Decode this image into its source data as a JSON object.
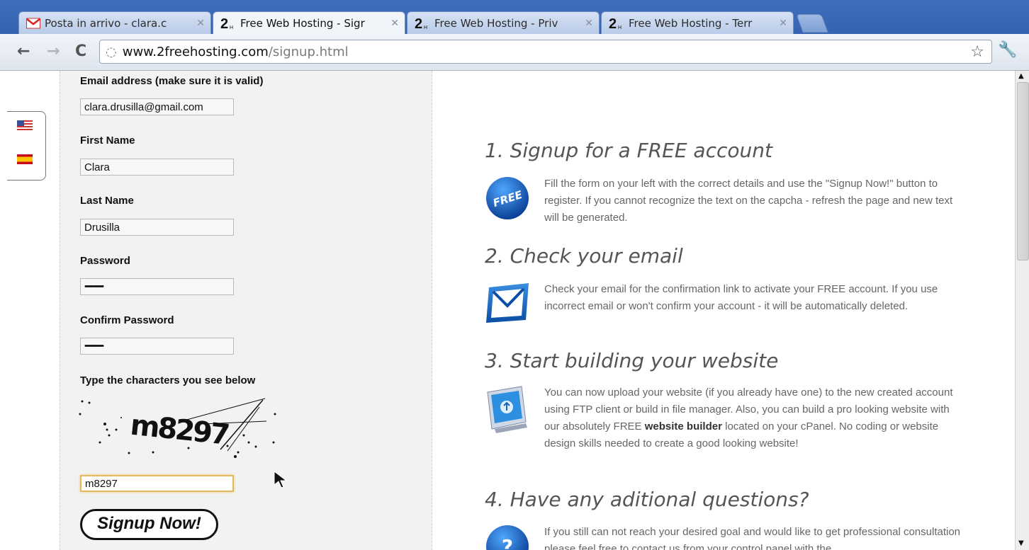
{
  "browser": {
    "tabs": [
      {
        "title": "Posta in arrivo - clara.c",
        "favicon": "gmail-icon",
        "active": false
      },
      {
        "title": "Free Web Hosting - Sigr",
        "favicon": "2freehosting-icon",
        "active": true
      },
      {
        "title": "Free Web Hosting - Priv",
        "favicon": "2freehosting-icon",
        "active": false
      },
      {
        "title": "Free Web Hosting - Terr",
        "favicon": "2freehosting-icon",
        "active": false
      }
    ],
    "url_host": "www.2freehosting.com",
    "url_path": "/signup.html"
  },
  "form": {
    "email_label": "Email address (make sure it is valid)",
    "email_value": "clara.drusilla@gmail.com",
    "first_name_label": "First Name",
    "first_name_value": "Clara",
    "last_name_label": "Last Name",
    "last_name_value": "Drusilla",
    "password_label": "Password",
    "password_value": "••••••••••••••",
    "confirm_label": "Confirm Password",
    "confirm_value": "••••••••••••••",
    "captcha_label": "Type the characters you see below",
    "captcha_image_text": "m8297",
    "captcha_value": "m8297",
    "submit_label": "Signup Now!"
  },
  "steps": [
    {
      "title": "1. Signup for a FREE account",
      "icon": "free-badge-icon",
      "icon_text": "FREE",
      "text": "Fill the form on your left with the correct details and use the \"Signup Now!\" button to register. If you cannot recognize the text on the capcha - refresh the page and new text will be generated."
    },
    {
      "title": "2. Check your email",
      "icon": "email-envelope-icon",
      "text": "Check your email for the confirmation link to activate your FREE account. If you use incorrect email or won't confirm your account - it will be automatically deleted."
    },
    {
      "title": "3. Start building your website",
      "icon": "monitor-upload-icon",
      "text_before": "You can now upload your website (if you already have one) to the new created account using FTP client or build in file manager. Also, you can build a pro looking website with our absolutely FREE ",
      "text_bold": "website builder",
      "text_after": " located on your cPanel. No coding or website design skills needed to create a good looking website!"
    },
    {
      "title": "4. Have any aditional questions?",
      "icon": "question-badge-icon",
      "icon_text": "?",
      "text": "If you still can not reach your desired goal and would like to get professional consultation please feel free to contact us from your control panel with the"
    }
  ],
  "colors": {
    "tabstrip": "#3f6fbd",
    "left_panel": "#f2f2f2",
    "heading": "#555555",
    "body_text": "#666666",
    "focus_border": "#e3b85e"
  }
}
